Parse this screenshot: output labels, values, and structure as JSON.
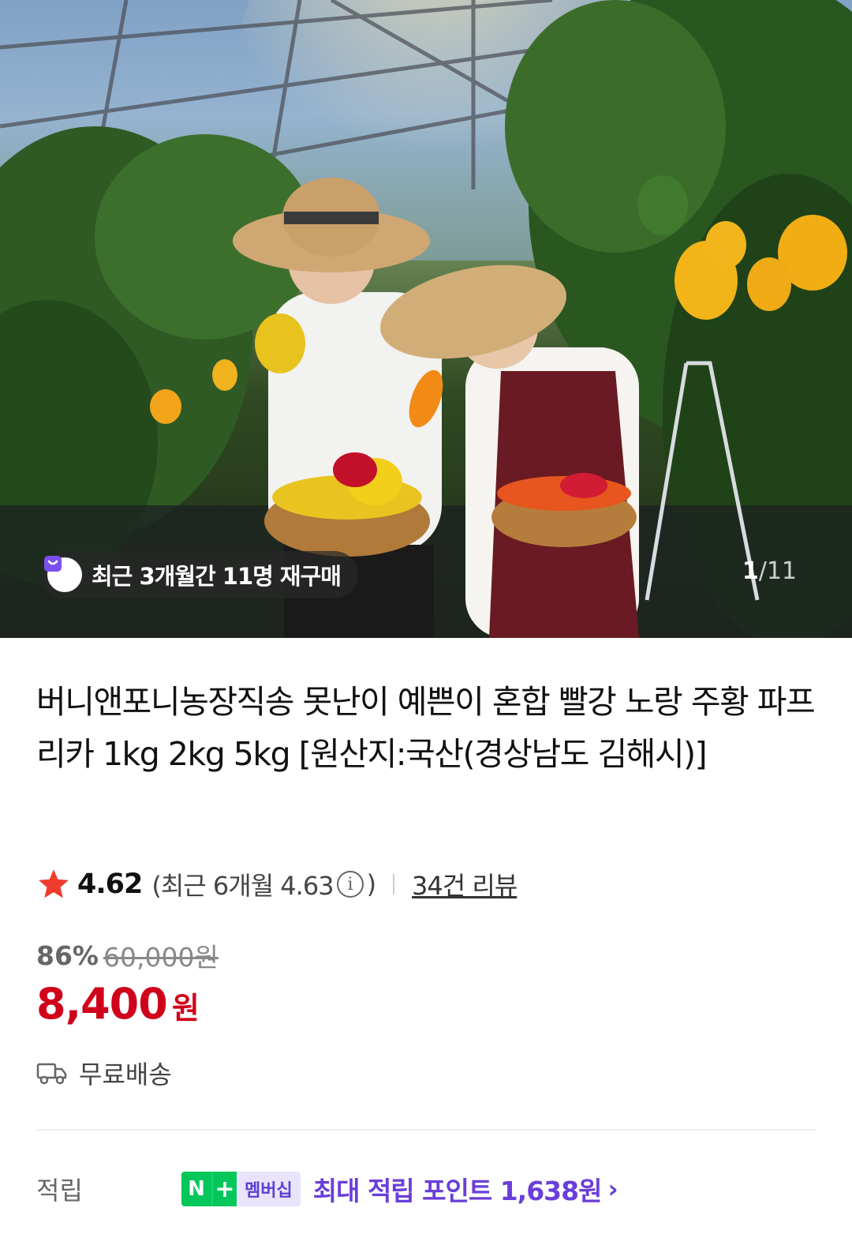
{
  "hero": {
    "rebuy_badge": "최근 3개월간 11명 재구매",
    "pager_current": "1",
    "pager_separator": "/",
    "pager_total": "11"
  },
  "product": {
    "title": "버니앤포니농장직송 못난이 예쁜이 혼합 빨강 노랑 주황 파프리카 1kg 2kg 5kg [원산지:국산(경상남도 김해시)]"
  },
  "rating": {
    "score": "4.62",
    "recent_prefix": "(최근 6개월 4.63",
    "recent_suffix": ")",
    "info_glyph": "i",
    "reviews_link": "34건 리뷰"
  },
  "price": {
    "discount": "86%",
    "original": "60,000원",
    "sale": "8,400",
    "currency": "원"
  },
  "shipping": {
    "label": "무료배송"
  },
  "points": {
    "label": "적립",
    "npay_n": "N",
    "npay_plus": "+",
    "npay_membership": "멤버십",
    "max_points_text": "최대 적립 포인트 1,638원",
    "chevron": "›"
  },
  "colors": {
    "sale_price": "#d0021b",
    "points_accent": "#6a3ed8",
    "npay_green": "#03c75a",
    "star": "#f03c2f"
  },
  "icons": {
    "rebuy": "shopping-bag-icon",
    "star": "star-icon",
    "info": "info-icon",
    "shipping": "truck-icon",
    "chevron": "chevron-right-icon"
  }
}
